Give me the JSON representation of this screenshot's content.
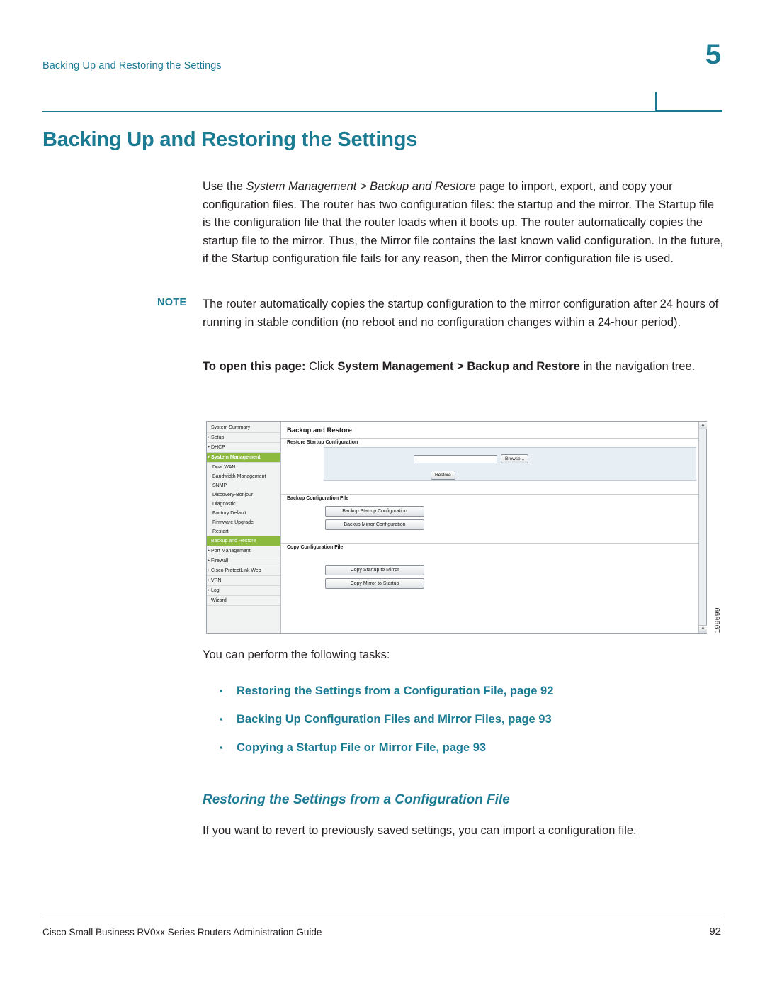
{
  "header": {
    "running_head": "Backing Up and Restoring the Settings",
    "chapter_number": "5"
  },
  "title": "Backing Up and Restoring the Settings",
  "paragraphs": {
    "intro_1": "Use the ",
    "intro_italic": "System Management > Backup and Restore",
    "intro_2": " page to import, export, and copy your configuration files. The router has two configuration files: the startup and the mirror. The Startup file is the configuration file that the router loads when it boots up. The router automatically copies the startup file to the mirror. Thus, the Mirror file contains the last known valid configuration. In the future, if the Startup configuration file fails for any reason, then the Mirror configuration file is used."
  },
  "note": {
    "label": "NOTE",
    "text": "The router automatically copies the startup configuration to the mirror configuration after 24 hours of running in stable condition (no reboot and no configuration changes within a 24-hour period)."
  },
  "to_open": {
    "lead": "To open this page:",
    "click": " Click ",
    "path": "System Management > Backup and Restore",
    "tail": " in the navigation tree."
  },
  "figure": {
    "id": "199699",
    "nav": [
      {
        "label": "System Summary",
        "type": "plain"
      },
      {
        "label": "Setup",
        "type": "hdr"
      },
      {
        "label": "DHCP",
        "type": "hdr"
      },
      {
        "label": "System Management",
        "type": "open-hdr"
      },
      {
        "label": "Dual WAN",
        "type": "sub"
      },
      {
        "label": "Bandwidth Management",
        "type": "sub"
      },
      {
        "label": "SNMP",
        "type": "sub"
      },
      {
        "label": "Discovery-Bonjour",
        "type": "sub"
      },
      {
        "label": "Diagnostic",
        "type": "sub"
      },
      {
        "label": "Factory Default",
        "type": "sub"
      },
      {
        "label": "Firmware Upgrade",
        "type": "sub"
      },
      {
        "label": "Restart",
        "type": "sub"
      },
      {
        "label": "Backup and Restore",
        "type": "selected"
      },
      {
        "label": "Port Management",
        "type": "hdr"
      },
      {
        "label": "Firewall",
        "type": "hdr"
      },
      {
        "label": "Cisco ProtectLink Web",
        "type": "hdr"
      },
      {
        "label": "VPN",
        "type": "hdr"
      },
      {
        "label": "Log",
        "type": "hdr"
      },
      {
        "label": "Wizard",
        "type": "plain"
      }
    ],
    "main_title": "Backup and Restore",
    "sections": {
      "restore": {
        "label": "Restore Startup Configuration",
        "file_value": "",
        "browse_button": "Browse...",
        "restore_button": "Restore"
      },
      "backup": {
        "label": "Backup Configuration File",
        "buttons": [
          "Backup Startup Configuration",
          "Backup Mirror Configuration"
        ]
      },
      "copy": {
        "label": "Copy Configuration File",
        "buttons": [
          "Copy Startup to Mirror",
          "Copy Mirror to Startup"
        ]
      }
    }
  },
  "tasks": {
    "intro": "You can perform the following tasks:",
    "items": [
      "Restoring the Settings from a Configuration File, page 92",
      "Backing Up Configuration Files and Mirror Files, page 93",
      "Copying a Startup File or Mirror File, page 93"
    ]
  },
  "subsection": {
    "heading": "Restoring the Settings from a Configuration File",
    "body": "If you want to revert to previously saved settings, you can import a configuration file."
  },
  "footer": {
    "left": "Cisco Small Business RV0xx Series Routers Administration Guide",
    "page": "92"
  },
  "colors": {
    "accent": "#1b7b93",
    "nav_selected": "#8cba3f",
    "text": "#231f20"
  }
}
